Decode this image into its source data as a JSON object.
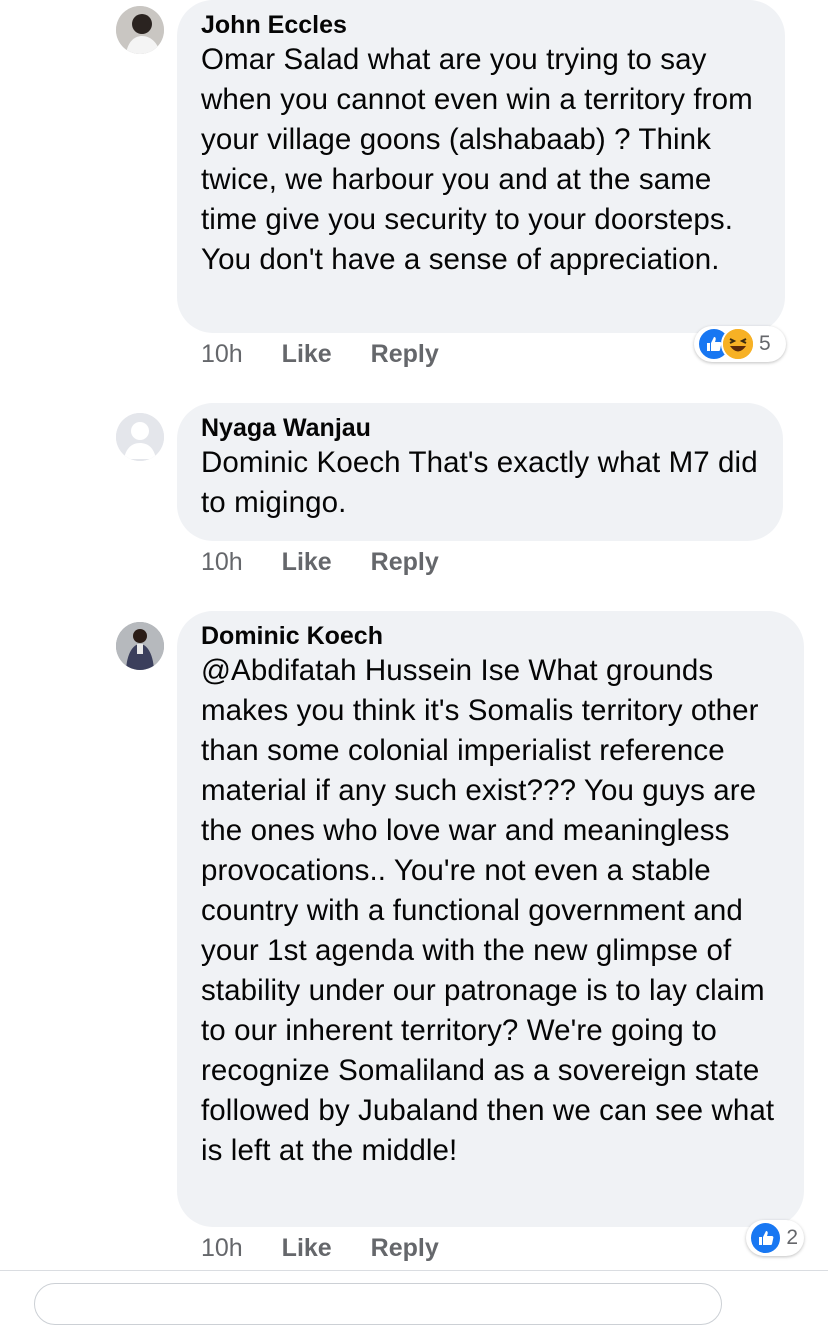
{
  "comments": [
    {
      "author": "John Eccles",
      "text": "Omar Salad what are you trying to say when you cannot even win a territory from your village goons (alshabaab) ? Think twice, we harbour you and at the same time give you security to your doorsteps. You don't have a sense of appreciation.",
      "time": "10h",
      "like": "Like",
      "reply": "Reply",
      "reactions": {
        "icons": [
          "like-icon",
          "haha-icon"
        ],
        "count": "5"
      }
    },
    {
      "author": "Nyaga Wanjau",
      "text": "Dominic Koech That's exactly what M7 did to migingo.",
      "time": "10h",
      "like": "Like",
      "reply": "Reply"
    },
    {
      "author": "Dominic Koech",
      "text": "@Abdifatah Hussein Ise What grounds makes you think it's Somalis territory other than some colonial imperialist reference material if any such exist??? You guys are the ones who love war and meaningless provocations.. You're not even a stable country with a functional government and your 1st agenda with the new glimpse of stability under our patronage is to lay claim to our inherent territory? We're going to recognize Somaliland as a sovereign state followed by Jubaland then we can see what is left at the middle!",
      "time": "10h",
      "like": "Like",
      "reply": "Reply",
      "reactions": {
        "icons": [
          "like-icon"
        ],
        "count": "2"
      }
    }
  ],
  "colors": {
    "bubble": "#f0f2f5",
    "meta": "#65676b",
    "like": "#1877f2",
    "haha": "#f7b125"
  }
}
